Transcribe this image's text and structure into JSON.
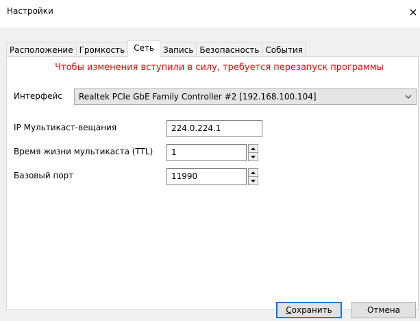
{
  "window": {
    "title": "Настройки",
    "close_label": "×"
  },
  "tabs": [
    {
      "label": "Расположение",
      "active": false
    },
    {
      "label": "Громкость",
      "active": false
    },
    {
      "label": "Сеть",
      "active": true
    },
    {
      "label": "Запись",
      "active": false
    },
    {
      "label": "Безопасность",
      "active": false
    },
    {
      "label": "События",
      "active": false
    }
  ],
  "network": {
    "notice": "Чтобы изменения вступили в силу, требуется перезапуск программы",
    "interface_label": "Интерфейс",
    "interface_value": "Realtek PCIe GbE Family Controller #2 [192.168.100.104]",
    "multicast_ip_label": "IP Мультикаст-вещания",
    "multicast_ip_value": "224.0.224.1",
    "ttl_label": "Время жизни мультикаста (TTL)",
    "ttl_value": "1",
    "base_port_label": "Базовый порт",
    "base_port_value": "11990"
  },
  "buttons": {
    "save_first": "С",
    "save_rest": "охранить",
    "cancel": "Отмена"
  },
  "colors": {
    "notice": "#ff0000",
    "accent": "#0078d7"
  },
  "icons": {
    "close": "close-icon",
    "dropdown": "chevron-down-icon",
    "spin_up": "arrow-up-icon",
    "spin_down": "arrow-down-icon"
  }
}
